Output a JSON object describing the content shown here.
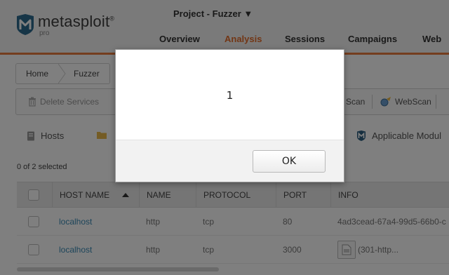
{
  "app": {
    "logo_name": "metasploit",
    "logo_registered": "®",
    "logo_edition": "pro",
    "project_title": "Project - Fuzzer ▼"
  },
  "nav": {
    "items": [
      {
        "label": "Overview"
      },
      {
        "label": "Analysis"
      },
      {
        "label": "Sessions"
      },
      {
        "label": "Campaigns"
      },
      {
        "label": "Web"
      }
    ],
    "active_index": 1
  },
  "breadcrumb": [
    "Home",
    "Fuzzer"
  ],
  "toolbar": {
    "delete_services": "Delete Services",
    "scan": "Scan",
    "webscan": "WebScan"
  },
  "tabs": {
    "hosts": "Hosts",
    "applicable_modules": "Applicable Modul"
  },
  "selection_count": "0 of 2 selected",
  "table": {
    "columns": [
      "HOST NAME",
      "NAME",
      "PROTOCOL",
      "PORT",
      "INFO"
    ],
    "rows": [
      {
        "host": "localhost",
        "name": "http",
        "protocol": "tcp",
        "port": "80",
        "info": "4ad3cead-67a4-99d5-66b0-c"
      },
      {
        "host": "localhost",
        "name": "http",
        "protocol": "tcp",
        "port": "3000",
        "info": "(301-http..."
      }
    ]
  },
  "dialog": {
    "message": "1",
    "ok_label": "OK"
  },
  "colors": {
    "accent": "#e46c2a",
    "link": "#3a8bb5",
    "overlay": "#000000"
  }
}
